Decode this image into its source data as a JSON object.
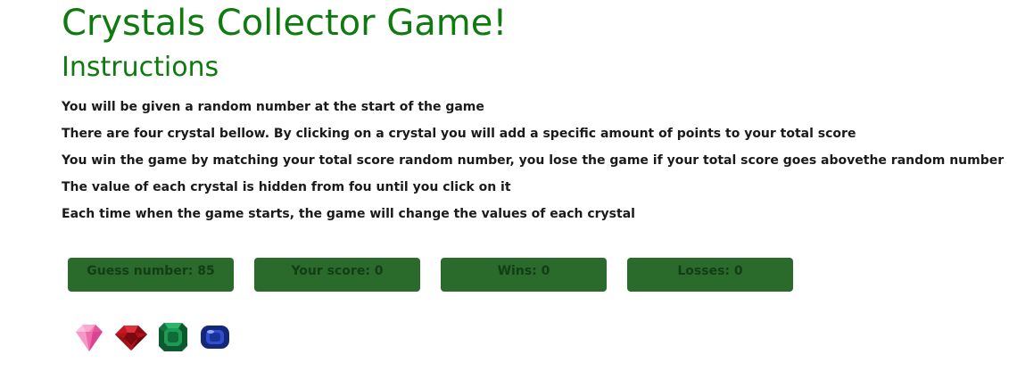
{
  "header": {
    "title": "Crystals Collector Game!",
    "subtitle": "Instructions"
  },
  "instructions": [
    "You will be given a random number at the start of the game",
    "There are four crystal bellow. By clicking on a crystal you will add a specific amount of points to your total score",
    "You win the game by matching your total score random number, you lose the game if your total score goes abovethe random number",
    "The value of each crystal is hidden from fou until you click on it",
    "Each time when the game starts, the game will change the values of each crystal"
  ],
  "stats": {
    "guess": "Guess number: 85",
    "score": "Your score: 0",
    "wins": "Wins: 0",
    "losses": "Losses: 0"
  },
  "crystals": [
    {
      "icon": "pink-diamond-icon",
      "color": "#f06fb0"
    },
    {
      "icon": "red-ruby-icon",
      "color": "#c4161c"
    },
    {
      "icon": "green-emerald-icon",
      "color": "#1f8a4c"
    },
    {
      "icon": "blue-sapphire-icon",
      "color": "#1e3aa8"
    }
  ],
  "colors": {
    "heading": "#0f7a0f",
    "stat_box": "#2a6b2c",
    "stat_text": "#133d14"
  }
}
